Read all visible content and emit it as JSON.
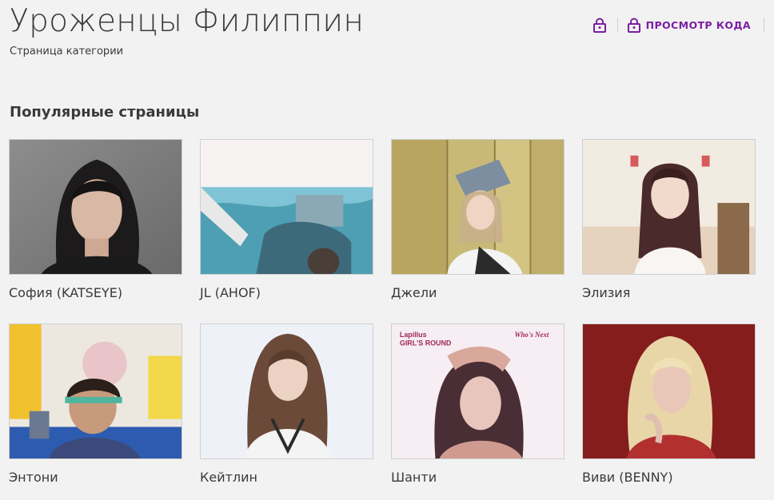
{
  "header": {
    "title": "Уроженцы Филиппин",
    "subtitle": "Страница категории",
    "view_source_label": "ПРОСМОТР КОДА",
    "accent_color": "#7b1fa2"
  },
  "section": {
    "title": "Популярные страницы"
  },
  "cards": [
    {
      "label": "София (KATSEYE)"
    },
    {
      "label": "JL (AHOF)"
    },
    {
      "label": "Джели"
    },
    {
      "label": "Элизия"
    },
    {
      "label": "Энтони"
    },
    {
      "label": "Кейтлин"
    },
    {
      "label": "Шанти",
      "image_text": [
        "Lapillus",
        "GIRL'S ROUND",
        "Who's Next"
      ]
    },
    {
      "label": "Виви (BENNY)"
    }
  ],
  "icons": {
    "protection": "lock-icon",
    "view_source": "lock-icon"
  }
}
